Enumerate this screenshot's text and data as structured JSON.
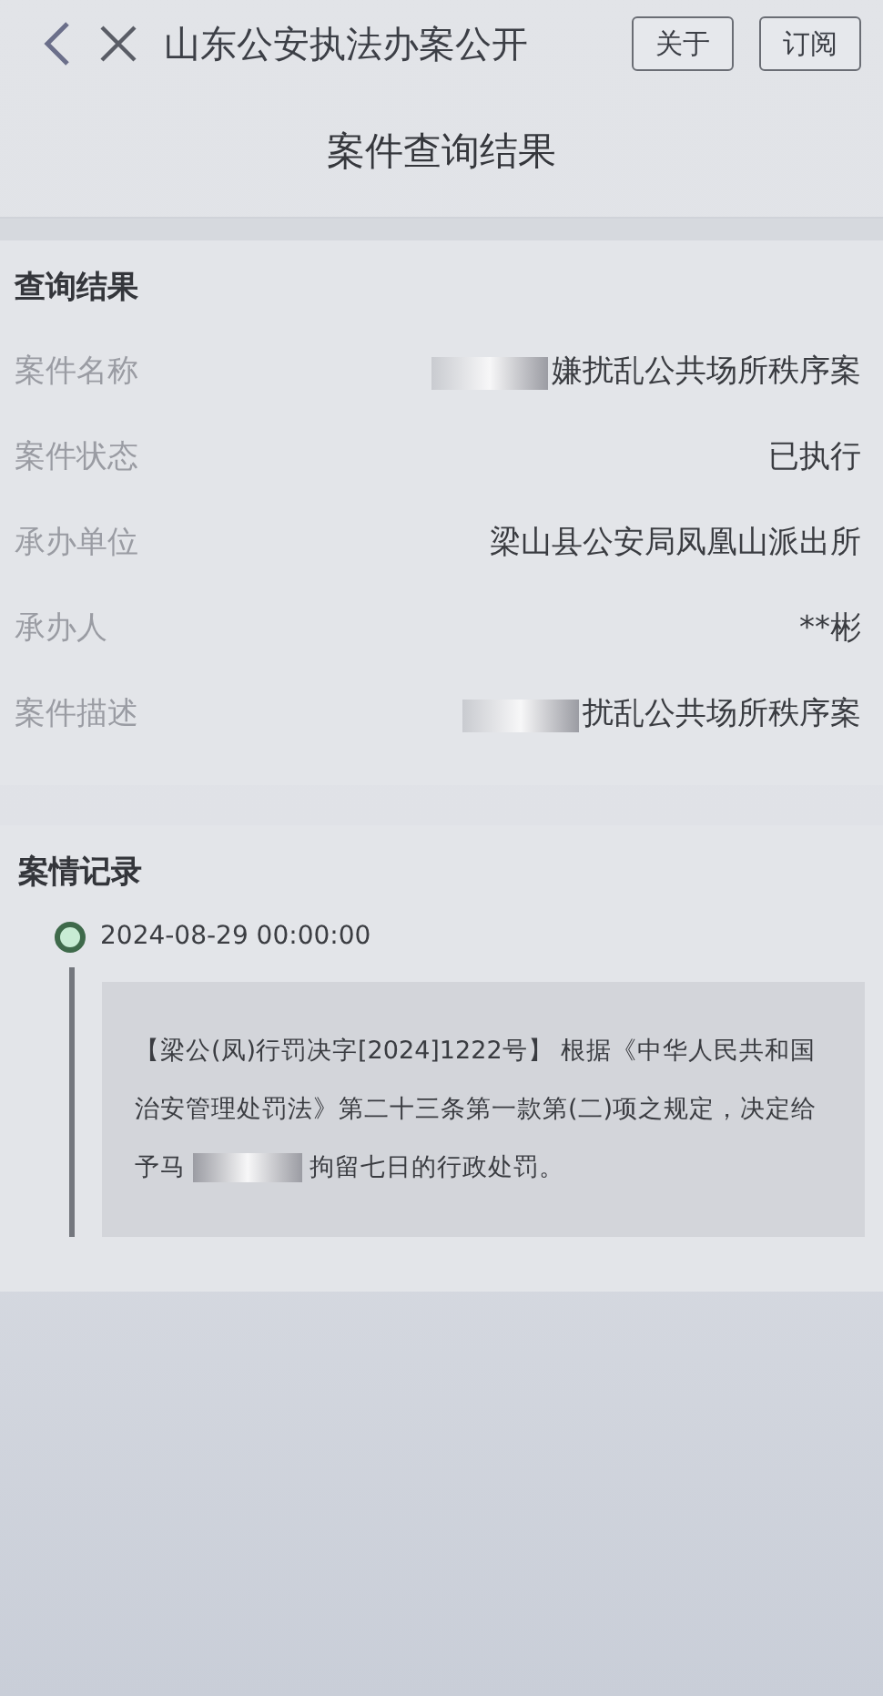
{
  "nav_bar": {
    "title": "山东公安执法办案公开",
    "buttons": [
      "关于",
      "订阅"
    ]
  },
  "page_title": "案件查询结果",
  "result_section": {
    "heading": "查询结果",
    "rows": [
      {
        "label": "案件名称",
        "value": "嫌扰乱公共场所秩序案",
        "redacted": true
      },
      {
        "label": "案件状态",
        "value": "已执行",
        "redacted": false
      },
      {
        "label": "承办单位",
        "value": "梁山县公安局凤凰山派出所",
        "redacted": false
      },
      {
        "label": "承办人",
        "value": "**彬",
        "redacted": false
      },
      {
        "label": "案件描述",
        "value": "扰乱公共场所秩序案",
        "redacted": true
      }
    ]
  },
  "record_section": {
    "heading": "案情记录",
    "entries": [
      {
        "time": "2024-08-29 00:00:00",
        "text_before": "【梁公(凤)行罚决字[2024]1222号】 根据《中华人民共和国治安管理处罚法》第二十三条第一款第(二)项之规定，决定给予马",
        "text_after": "拘留七日的行政处罚。"
      }
    ]
  }
}
